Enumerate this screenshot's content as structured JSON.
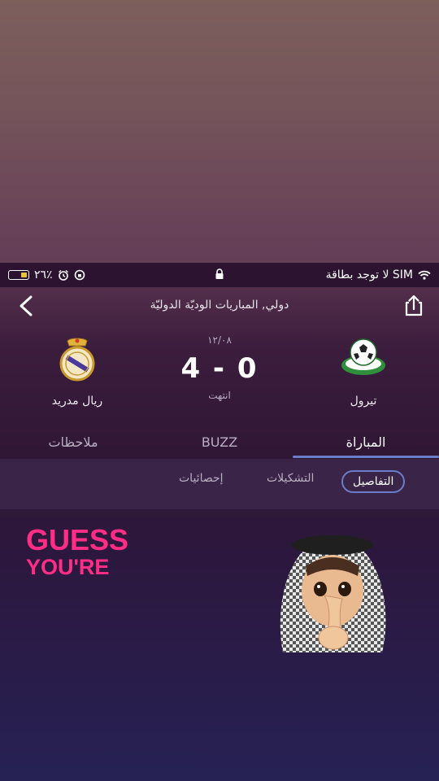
{
  "status_bar": {
    "carrier": "لا توجد بطاقة SIM",
    "battery": "٢٦٪"
  },
  "header": {
    "league": "دولي, المباريات الوديّة الدوليّة"
  },
  "match": {
    "date": "١٢/٠٨",
    "score": "4 - 0",
    "status": "انتهت",
    "home_team": "تيرول",
    "away_team": "ريال مدريد"
  },
  "tabs": {
    "match": "المباراة",
    "buzz": "BUZZ",
    "notes": "ملاحظات"
  },
  "sub_tabs": {
    "details": "التفاصيل",
    "lineups": "التشكيلات",
    "stats": "إحصائيات"
  },
  "overlay": {
    "line1": "GUESS",
    "line2": "YOU'RE"
  },
  "colors": {
    "accent": "#6b7dc9",
    "overlay_text": "#ff2d86"
  }
}
